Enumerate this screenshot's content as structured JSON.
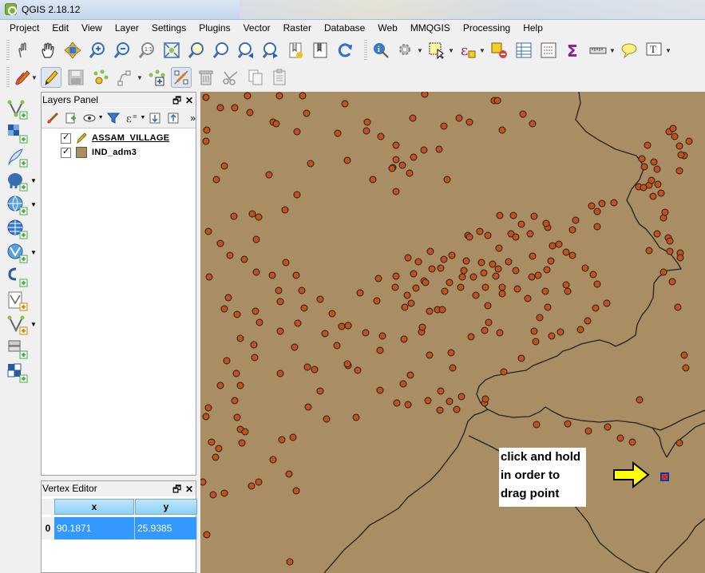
{
  "window": {
    "title": "QGIS 2.18.12"
  },
  "menu": [
    "Project",
    "Edit",
    "View",
    "Layer",
    "Settings",
    "Plugins",
    "Vector",
    "Raster",
    "Database",
    "Web",
    "MMQGIS",
    "Processing",
    "Help"
  ],
  "layers_panel": {
    "title": "Layers Panel",
    "layers": [
      {
        "name": "ASSAM_VILLAGE",
        "checked": true,
        "icon": "edit-pencil-icon"
      },
      {
        "name": "IND_adm3",
        "checked": true,
        "swatch": "#a98d63"
      }
    ]
  },
  "vertex_editor": {
    "title": "Vertex Editor",
    "columns": [
      "x",
      "y"
    ],
    "rows": [
      {
        "index": "0",
        "x": "90.1871",
        "y": "25.9385"
      }
    ]
  },
  "map": {
    "background": "#a98d63",
    "point_color": "#c0521e",
    "selected_vertex_color": "#1030c0",
    "annotation": [
      "click and hold",
      "in order to",
      "drag point"
    ]
  }
}
